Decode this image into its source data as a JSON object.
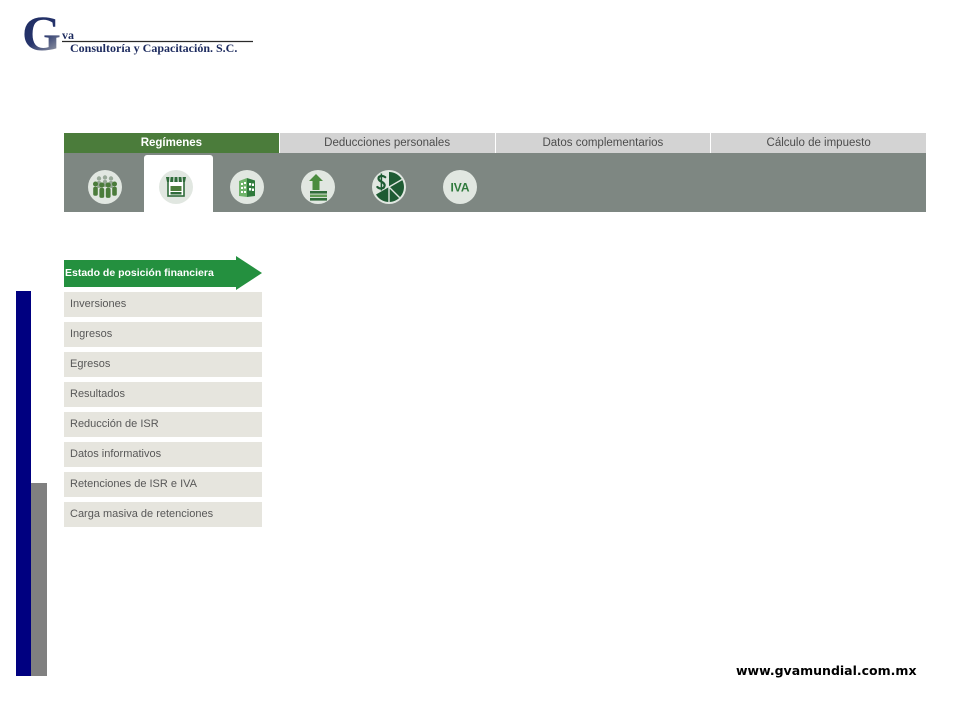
{
  "logo": {
    "mark": "G",
    "mark_suffix": "va",
    "company": "Consultoría y Capacitación. S.C."
  },
  "tabs": [
    {
      "label": "Regímenes",
      "active": true
    },
    {
      "label": "Deducciones personales",
      "active": false
    },
    {
      "label": "Datos complementarios",
      "active": false
    },
    {
      "label": "Cálculo de impuesto",
      "active": false
    }
  ],
  "regime_icons": [
    {
      "icon": "people-group-icon",
      "selected": false
    },
    {
      "icon": "store-icon",
      "selected": true
    },
    {
      "icon": "building-icon",
      "selected": false
    },
    {
      "icon": "money-growth-icon",
      "selected": false
    },
    {
      "icon": "dollar-pie-chart-icon",
      "selected": false
    },
    {
      "icon": "iva-icon",
      "label": "IVA",
      "selected": false
    }
  ],
  "side_menu": {
    "active_item": "Estado de posición financiera",
    "items": [
      "Inversiones",
      "Ingresos",
      "Egresos",
      "Resultados",
      "Reducción de ISR",
      "Datos informativos",
      "Retenciones de ISR e IVA",
      "Carga masiva de retenciones"
    ]
  },
  "footer": {
    "website": "www.gvamundial.com.mx"
  },
  "colors": {
    "logo_navy": "#1c2a5e",
    "tab_active": "#4b7c3b",
    "tab_inactive": "#d3d3d3",
    "icon_bar": "#7e8782",
    "menu_active": "#24903f",
    "menu_item": "#e6e5de",
    "accent_bar_navy": "#000080",
    "accent_bar_gray": "#808080"
  }
}
